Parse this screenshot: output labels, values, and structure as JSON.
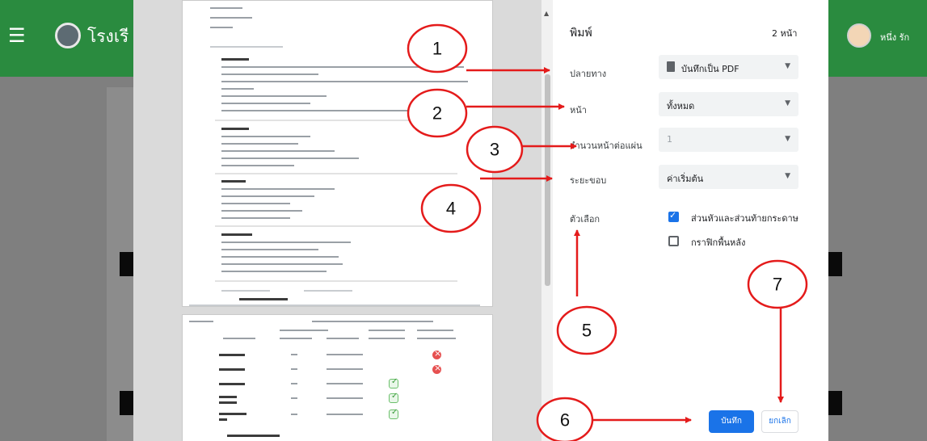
{
  "app": {
    "school_name": "โรงเรี",
    "user_name": "หนึ่ง รัก"
  },
  "dialog": {
    "title": "พิมพ์",
    "page_count": "2 หน้า",
    "fields": {
      "destination": {
        "label": "ปลายทาง",
        "value": "บันทึกเป็น PDF"
      },
      "pages": {
        "label": "หน้า",
        "value": "ทั้งหมด"
      },
      "pages_per_sheet": {
        "label": "จำนวนหน้าต่อแผ่น",
        "value": "1"
      },
      "margins": {
        "label": "ระยะขอบ",
        "value": "ค่าเริ่มต้น"
      }
    },
    "options": {
      "label": "ตัวเลือก",
      "headers_footers": {
        "label": "ส่วนหัวและส่วนท้ายกระดาษ",
        "checked": true
      },
      "background_graphics": {
        "label": "กราฟิกพื้นหลัง",
        "checked": false
      }
    },
    "buttons": {
      "save": "บันทึก",
      "cancel": "ยกเลิก"
    }
  },
  "annotations": {
    "color": "#e41b1b",
    "markers": [
      "1",
      "2",
      "3",
      "4",
      "5",
      "6",
      "7"
    ]
  }
}
